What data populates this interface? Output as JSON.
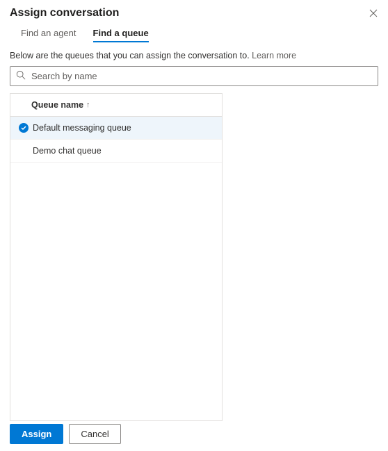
{
  "title": "Assign conversation",
  "tabs": {
    "agent": "Find an agent",
    "queue": "Find a queue"
  },
  "description": "Below are the queues that you can assign the conversation to.",
  "learn_more": "Learn more",
  "search": {
    "placeholder": "Search by name"
  },
  "table": {
    "header": "Queue name",
    "rows": [
      {
        "label": "Default messaging queue",
        "selected": true
      },
      {
        "label": "Demo chat queue",
        "selected": false
      }
    ]
  },
  "buttons": {
    "assign": "Assign",
    "cancel": "Cancel"
  }
}
